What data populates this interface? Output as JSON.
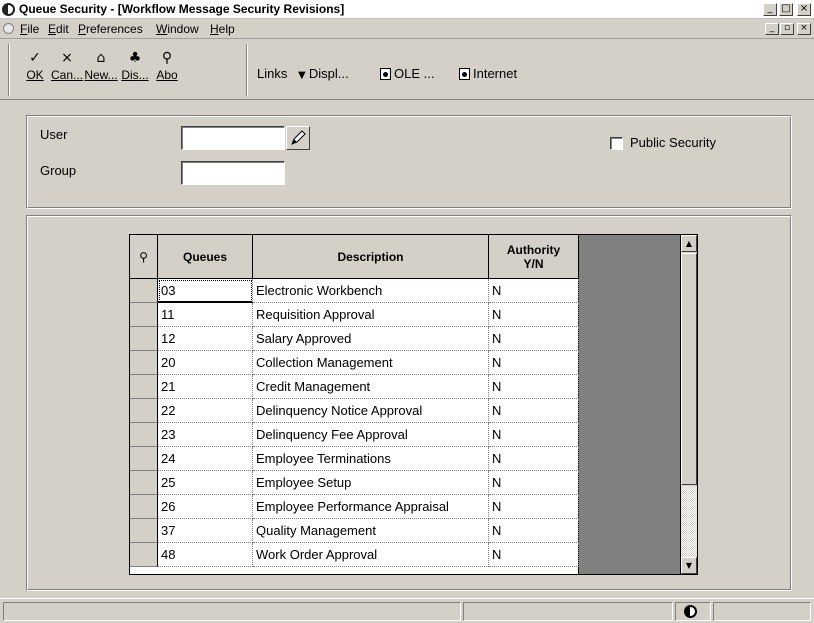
{
  "window": {
    "title": "Queue Security - [Workflow Message Security Revisions]"
  },
  "menubar": {
    "items": [
      {
        "label": "File",
        "hotkey": "F"
      },
      {
        "label": "Edit",
        "hotkey": "E"
      },
      {
        "label": "Preferences",
        "hotkey": "P"
      },
      {
        "label": "Window",
        "hotkey": "W"
      },
      {
        "label": "Help",
        "hotkey": "H"
      }
    ]
  },
  "toolbar": {
    "ok_label": "OK",
    "cancel_label": "Can...",
    "new_label": "New...",
    "display_label": "Dis...",
    "about_label": "Abo",
    "links_label": "Links",
    "displ_label": "Displ...",
    "ole_label": "OLE ...",
    "internet_label": "Internet"
  },
  "form": {
    "user_label": "User",
    "user_value": "",
    "group_label": "Group",
    "group_value": "",
    "public_security_label": "Public Security",
    "public_security_checked": false
  },
  "grid": {
    "columns": [
      "Queues",
      "Description",
      "Authority\nY/N"
    ],
    "rows": [
      {
        "queue": "03",
        "description": "Electronic Workbench",
        "authority": "N"
      },
      {
        "queue": "11",
        "description": "Requisition Approval",
        "authority": "N"
      },
      {
        "queue": "12",
        "description": "Salary Approved",
        "authority": "N"
      },
      {
        "queue": "20",
        "description": "Collection Management",
        "authority": "N"
      },
      {
        "queue": "21",
        "description": "Credit Management",
        "authority": "N"
      },
      {
        "queue": "22",
        "description": "Delinquency Notice Approval",
        "authority": "N"
      },
      {
        "queue": "23",
        "description": "Delinquency Fee Approval",
        "authority": "N"
      },
      {
        "queue": "24",
        "description": "Employee Terminations",
        "authority": "N"
      },
      {
        "queue": "25",
        "description": "Employee Setup",
        "authority": "N"
      },
      {
        "queue": "26",
        "description": "Employee Performance Appraisal",
        "authority": "N"
      },
      {
        "queue": "37",
        "description": "Quality Management",
        "authority": "N"
      },
      {
        "queue": "48",
        "description": "Work Order Approval",
        "authority": "N"
      }
    ]
  },
  "icons": {
    "app": "app-globe-icon",
    "ok": "checkmark-icon",
    "cancel": "x-icon",
    "new": "new-record-icon",
    "display": "display-icon",
    "about": "about-help-icon",
    "links_dropdown": "triangle-down-icon",
    "ole": "document-icon",
    "internet": "document-icon",
    "visual_assist": "pencil-icon",
    "grid_query": "query-binoculars-icon",
    "status": "globe-icon"
  }
}
